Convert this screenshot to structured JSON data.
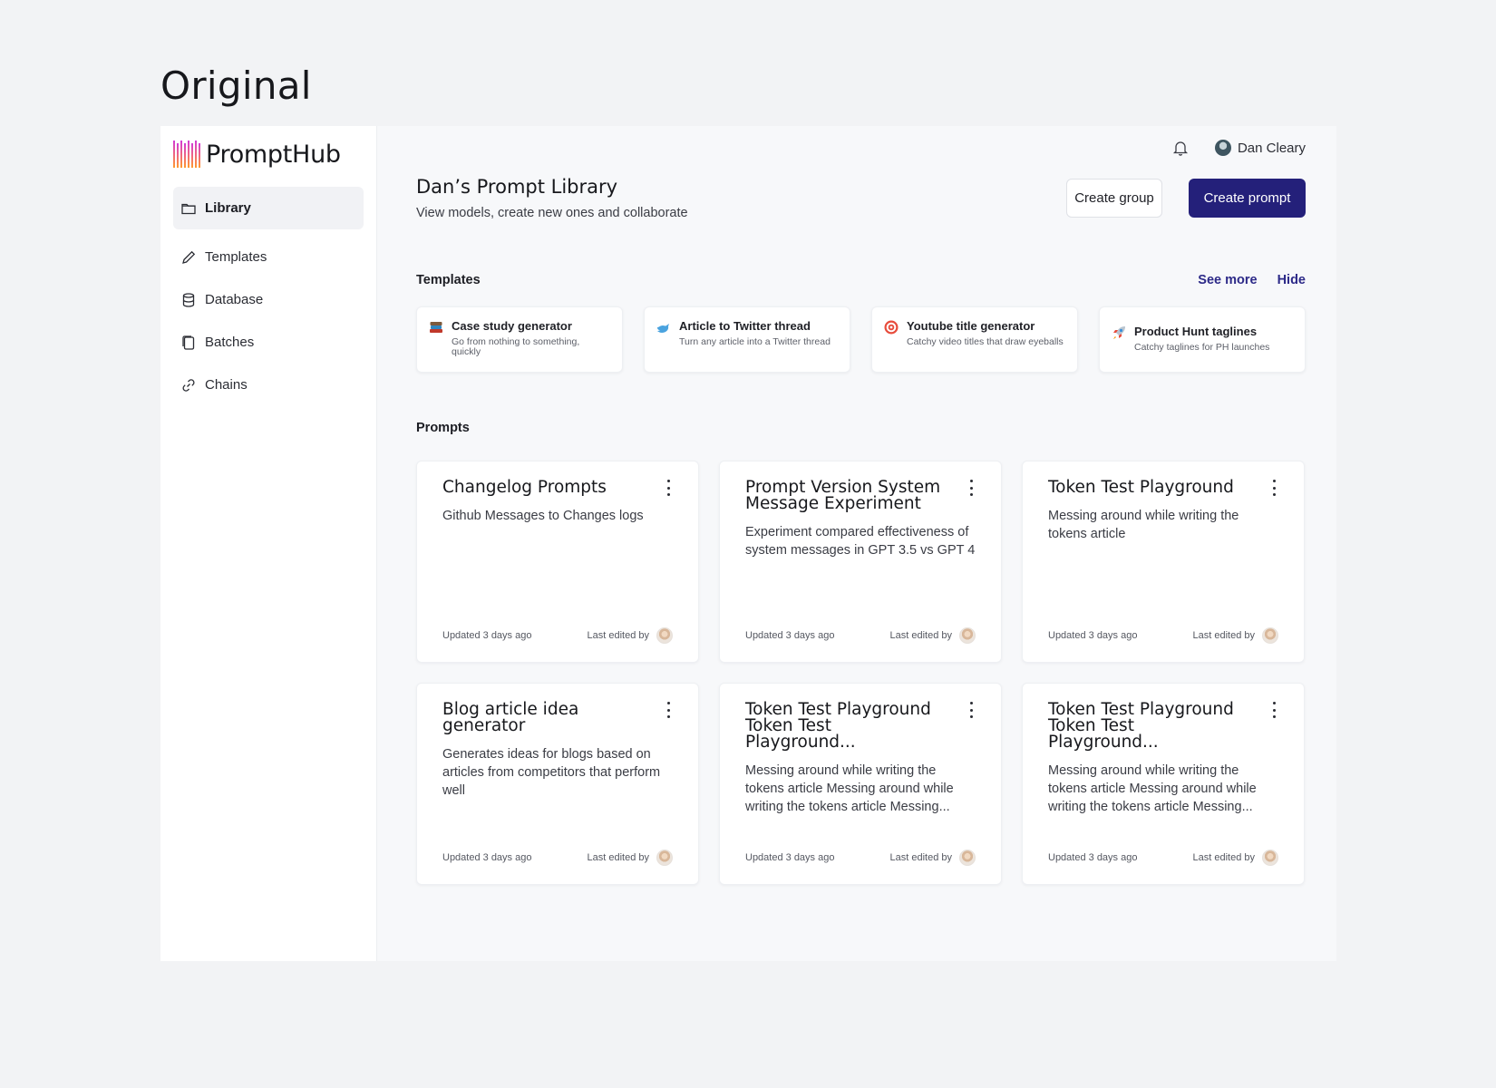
{
  "outer_title": "Original",
  "app": {
    "name": "PromptHub"
  },
  "sidebar": {
    "items": [
      {
        "label": "Library",
        "icon": "folder-icon",
        "active": true
      },
      {
        "label": "Templates",
        "icon": "pencil-icon"
      },
      {
        "label": "Database",
        "icon": "database-icon"
      },
      {
        "label": "Batches",
        "icon": "copy-icon"
      },
      {
        "label": "Chains",
        "icon": "link-icon"
      }
    ]
  },
  "topbar": {
    "user_name": "Dan Cleary"
  },
  "header": {
    "title": "Dan’s Prompt Library",
    "subtitle": "View models, create new ones and collaborate"
  },
  "actions": {
    "create_group": "Create group",
    "create_prompt": "Create prompt"
  },
  "templates": {
    "label": "Templates",
    "see_more": "See more",
    "hide": "Hide",
    "cards": [
      {
        "title": "Case study generator",
        "desc": "Go from nothing to something, quickly",
        "icon": "books-icon"
      },
      {
        "title": "Article to Twitter thread",
        "desc": "Turn any article into a Twitter thread",
        "icon": "bird-icon"
      },
      {
        "title": "Youtube title generator",
        "desc": "Catchy video titles that draw eyeballs",
        "icon": "target-icon"
      },
      {
        "title": "Product Hunt taglines",
        "desc": "Catchy taglines for PH launches",
        "icon": "rocket-icon"
      }
    ]
  },
  "prompts": {
    "label": "Prompts",
    "cards": [
      {
        "title": "Changelog Prompts",
        "desc": "Github Messages to Changes logs",
        "updated": "Updated 3 days ago",
        "edited": "Last edited by"
      },
      {
        "title": "Prompt Version System Message Experiment",
        "desc": "Experiment compared effectiveness of system messages in GPT 3.5 vs GPT 4",
        "updated": "Updated 3 days ago",
        "edited": "Last edited by"
      },
      {
        "title": "Token Test Playground",
        "desc": "Messing around while writing the tokens article",
        "updated": "Updated 3 days ago",
        "edited": "Last edited by"
      },
      {
        "title": "Blog article idea generator",
        "desc": "Generates ideas for blogs based on articles from competitors that perform well",
        "updated": "Updated 3 days ago",
        "edited": "Last edited by"
      },
      {
        "title": "Token Test Playground Token Test Playground...",
        "desc": "Messing around while writing the tokens article Messing around while writing the tokens article Messing...",
        "updated": "Updated 3 days ago",
        "edited": "Last edited by"
      },
      {
        "title": "Token Test Playground Token Test Playground...",
        "desc": "Messing around while writing the tokens article Messing around while writing the tokens article Messing...",
        "updated": "Updated 3 days ago",
        "edited": "Last edited by"
      }
    ]
  },
  "colors": {
    "primary": "#24207a",
    "link": "#2d2a88",
    "page_bg": "#f7f8fa"
  }
}
